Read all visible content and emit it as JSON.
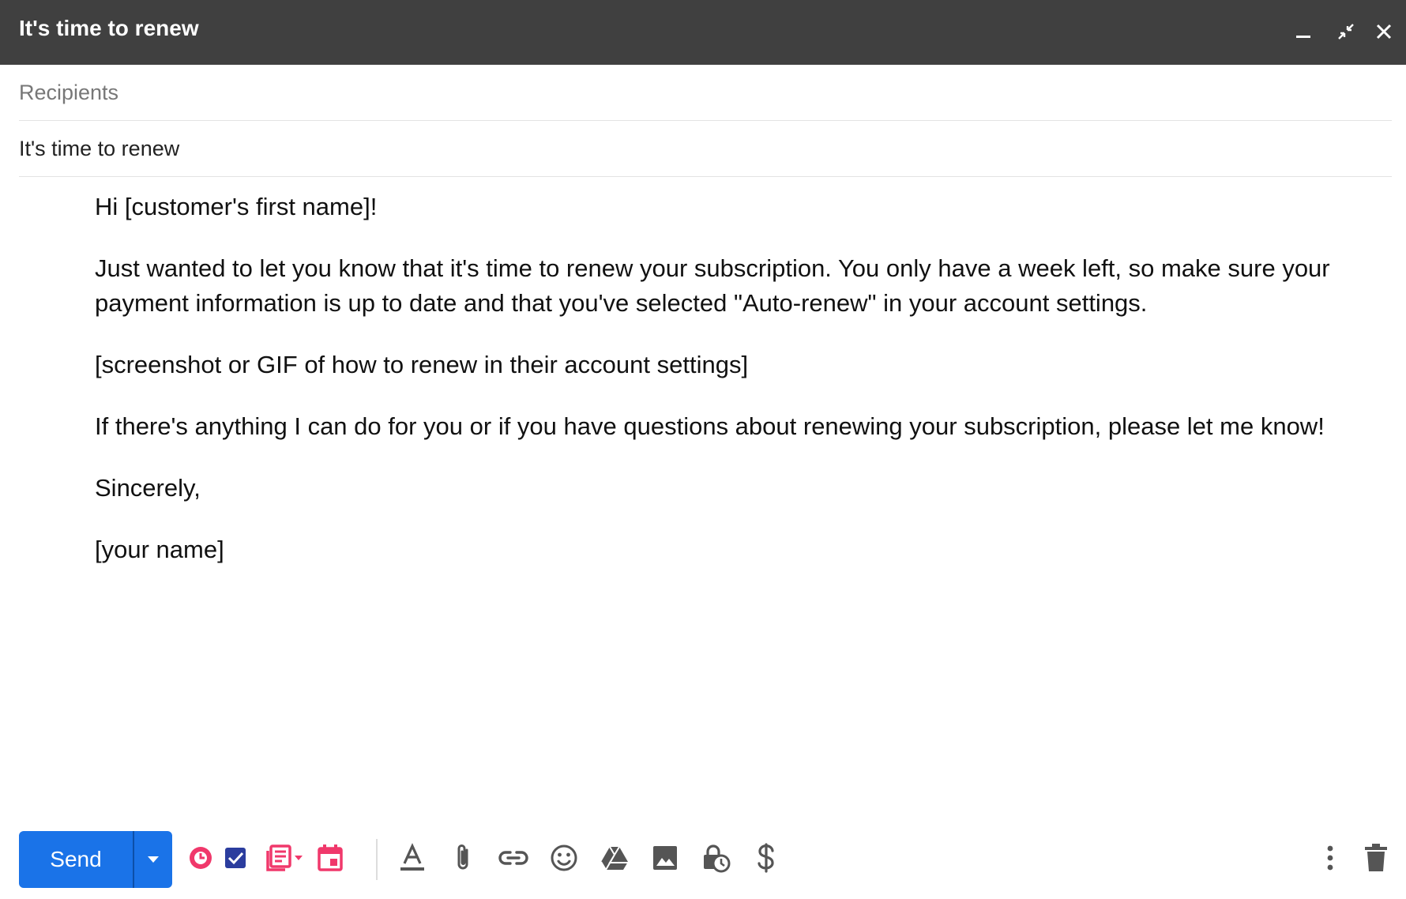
{
  "window": {
    "title": "It's time to renew"
  },
  "fields": {
    "recipients_placeholder": "Recipients",
    "recipients_value": "",
    "subject_value": "It's time to renew"
  },
  "message": {
    "paragraphs": [
      "Hi [customer's first name]!",
      "Just wanted to let you know that it's time to renew your subscription. You only have a week left, so make sure your payment information is up to date and that you've selected \"Auto-renew\" in your account settings.",
      "[screenshot or GIF of how to renew in their account settings]",
      "If there's anything I can do for you or if you have questions about renewing your subscription, please let me know!",
      "Sincerely,",
      "[your name]"
    ]
  },
  "toolbar": {
    "send_label": "Send",
    "icons": [
      "minimize-icon",
      "exit-fullscreen-icon",
      "close-icon",
      "send-options-icon",
      "snooze-clock-icon",
      "task-checkbox-icon",
      "template-icon",
      "calendar-icon",
      "text-format-icon",
      "attachment-icon",
      "link-icon",
      "emoji-icon",
      "drive-icon",
      "image-icon",
      "confidential-mode-icon",
      "money-icon",
      "more-options-icon",
      "trash-icon"
    ]
  },
  "colors": {
    "titlebar_bg": "#404040",
    "send_blue": "#1a73e8",
    "accent_pink": "#f0386b",
    "accent_navy": "#2b3d9e",
    "icon_gray": "#555555"
  }
}
